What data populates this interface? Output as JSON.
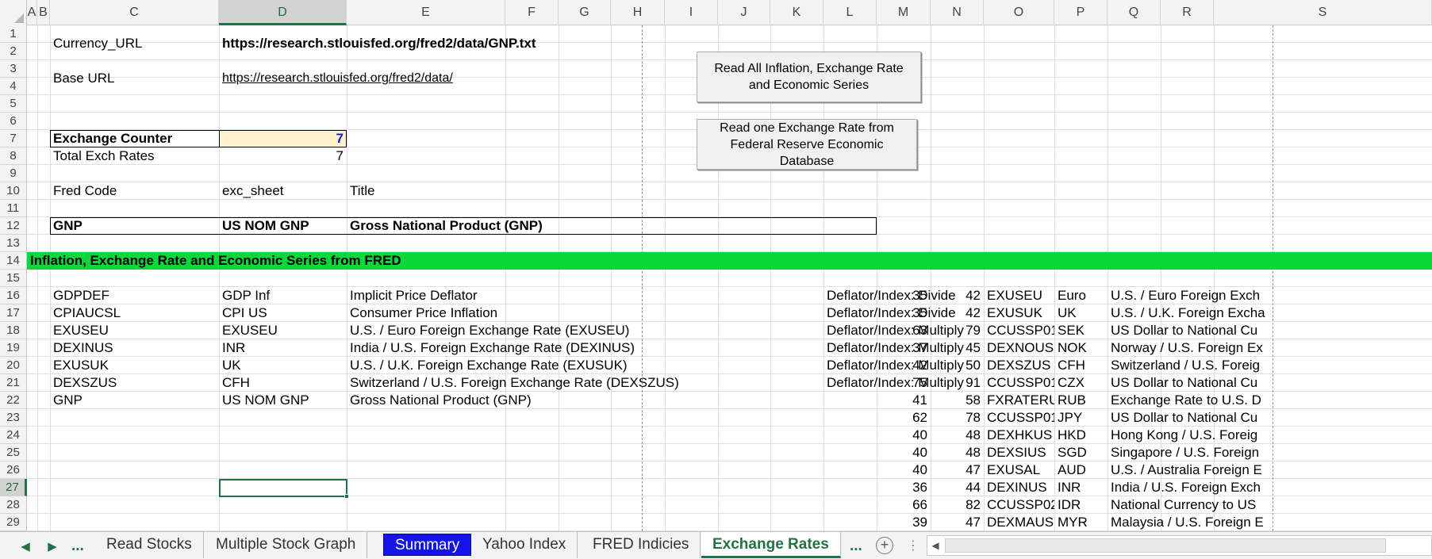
{
  "columns": [
    "A",
    "B",
    "C",
    "D",
    "E",
    "F",
    "G",
    "H",
    "I",
    "J",
    "K",
    "L",
    "M",
    "N",
    "O",
    "P",
    "Q",
    "R",
    "S"
  ],
  "active_column": "D",
  "rows": [
    "1",
    "2",
    "3",
    "4",
    "5",
    "6",
    "7",
    "8",
    "9",
    "10",
    "11",
    "12",
    "13",
    "14",
    "15",
    "16",
    "17",
    "18",
    "19",
    "20",
    "21",
    "22",
    "23",
    "24",
    "25",
    "26",
    "27",
    "28",
    "29"
  ],
  "active_row": "27",
  "params": {
    "currency_url_label": "Currency_URL",
    "currency_url_value": "https://research.stlouisfed.org/fred2/data/GNP.txt",
    "base_url_label": "Base URL",
    "base_url_value": "https://research.stlouisfed.org/fred2/data/",
    "exchange_counter_label": "Exchange Counter",
    "exchange_counter_value": "7",
    "total_exch_label": "Total Exch Rates",
    "total_exch_value": "7",
    "fred_code_header": "Fred Code",
    "exc_sheet_header": "exc_sheet",
    "title_header": "Title",
    "current_code": "GNP",
    "current_sheet": "US NOM GNP",
    "current_title": "Gross National Product (GNP)"
  },
  "buttons": {
    "read_all": "Read All Inflation, Exchange Rate and Economic Series",
    "read_one": "Read one Exchange Rate from Federal Reserve Economic Database"
  },
  "section_title": "Inflation, Exchange Rate and Economic Series from FRED",
  "series_rows": [
    {
      "code": "GDPDEF",
      "sheet": "GDP Inf",
      "title": "Implicit Price Deflator",
      "deflator": "Deflator/Index: Divide",
      "m": "35",
      "n": "42",
      "o": "EXUSEU",
      "p": "Euro",
      "q": "U.S. / Euro Foreign Exch"
    },
    {
      "code": "CPIAUCSL",
      "sheet": "CPI US",
      "title": "Consumer Price Inflation",
      "deflator": "Deflator/Index: Divide",
      "m": "35",
      "n": "42",
      "o": "EXUSUK",
      "p": "UK",
      "q": "U.S. / U.K. Foreign Excha"
    },
    {
      "code": "EXUSEU",
      "sheet": "EXUSEU",
      "title": "U.S. / Euro Foreign Exchange Rate (EXUSEU)",
      "deflator": "Deflator/Index: Multiply",
      "m": "63",
      "n": "79",
      "o": "CCUSSP01",
      "p": "SEK",
      "q": "US Dollar to National Cu"
    },
    {
      "code": "DEXINUS",
      "sheet": "INR",
      "title": "India / U.S. Foreign Exchange Rate (DEXINUS)",
      "deflator": "Deflator/Index: Multiply",
      "m": "37",
      "n": "45",
      "o": "DEXNOUS",
      "p": "NOK",
      "q": "Norway / U.S. Foreign Ex"
    },
    {
      "code": "EXUSUK",
      "sheet": "UK",
      "title": "U.S. / U.K. Foreign Exchange Rate (EXUSUK)",
      "deflator": "Deflator/Index: Multiply",
      "m": "42",
      "n": "50",
      "o": "DEXSZUS",
      "p": "CFH",
      "q": "Switzerland / U.S. Foreig"
    },
    {
      "code": "DEXSZUS",
      "sheet": "CFH",
      "title": "Switzerland / U.S. Foreign Exchange Rate (DEXSZUS)",
      "deflator": "Deflator/Index: Multiply",
      "m": "75",
      "n": "91",
      "o": "CCUSSP01",
      "p": "CZX",
      "q": "US Dollar to National Cu"
    },
    {
      "code": "GNP",
      "sheet": "US NOM GNP",
      "title": "Gross National Product (GNP)",
      "deflator": "",
      "m": "41",
      "n": "58",
      "o": "FXRATERU",
      "p": "RUB",
      "q": "Exchange Rate to U.S. D"
    },
    {
      "code": "",
      "sheet": "",
      "title": "",
      "deflator": "",
      "m": "62",
      "n": "78",
      "o": "CCUSSP01",
      "p": "JPY",
      "q": "US Dollar to National Cu"
    },
    {
      "code": "",
      "sheet": "",
      "title": "",
      "deflator": "",
      "m": "40",
      "n": "48",
      "o": "DEXHKUS",
      "p": "HKD",
      "q": "Hong Kong / U.S. Foreig"
    },
    {
      "code": "",
      "sheet": "",
      "title": "",
      "deflator": "",
      "m": "40",
      "n": "48",
      "o": "DEXSIUS",
      "p": "SGD",
      "q": "Singapore / U.S. Foreign"
    },
    {
      "code": "",
      "sheet": "",
      "title": "",
      "deflator": "",
      "m": "40",
      "n": "47",
      "o": "EXUSAL",
      "p": "AUD",
      "q": "U.S. / Australia Foreign E"
    },
    {
      "code": "",
      "sheet": "",
      "title": "",
      "deflator": "",
      "m": "36",
      "n": "44",
      "o": "DEXINUS",
      "p": "INR",
      "q": "India / U.S. Foreign Exch"
    },
    {
      "code": "",
      "sheet": "",
      "title": "",
      "deflator": "",
      "m": "66",
      "n": "82",
      "o": "CCUSSP02",
      "p": "IDR",
      "q": "National Currency to US"
    },
    {
      "code": "",
      "sheet": "",
      "title": "",
      "deflator": "",
      "m": "39",
      "n": "47",
      "o": "DEXMAUS",
      "p": "MYR",
      "q": "Malaysia / U.S. Foreign E"
    }
  ],
  "tabs": {
    "prev_icon": "triangle-left-icon",
    "next_icon": "triangle-right-icon",
    "ellipsis_left": "...",
    "sheets": [
      "Read Stocks",
      "Multiple Stock Graph",
      "Summary",
      "Yahoo Index",
      "FRED Indicies",
      "Exchange Rates"
    ],
    "active_sheet": "Exchange Rates",
    "highlight_sheet": "Summary",
    "ellipsis_right": "...",
    "add_icon": "plus-circle-icon",
    "add_label": "+",
    "more_icon": "vertical-dots-icon",
    "more_label": "⋮"
  },
  "colors": {
    "green_band": "#0bd63a",
    "yellow_input": "#fff2cc",
    "blue_value": "#1a1acb",
    "excel_green": "#217346",
    "summary_tab": "#1414e6"
  }
}
